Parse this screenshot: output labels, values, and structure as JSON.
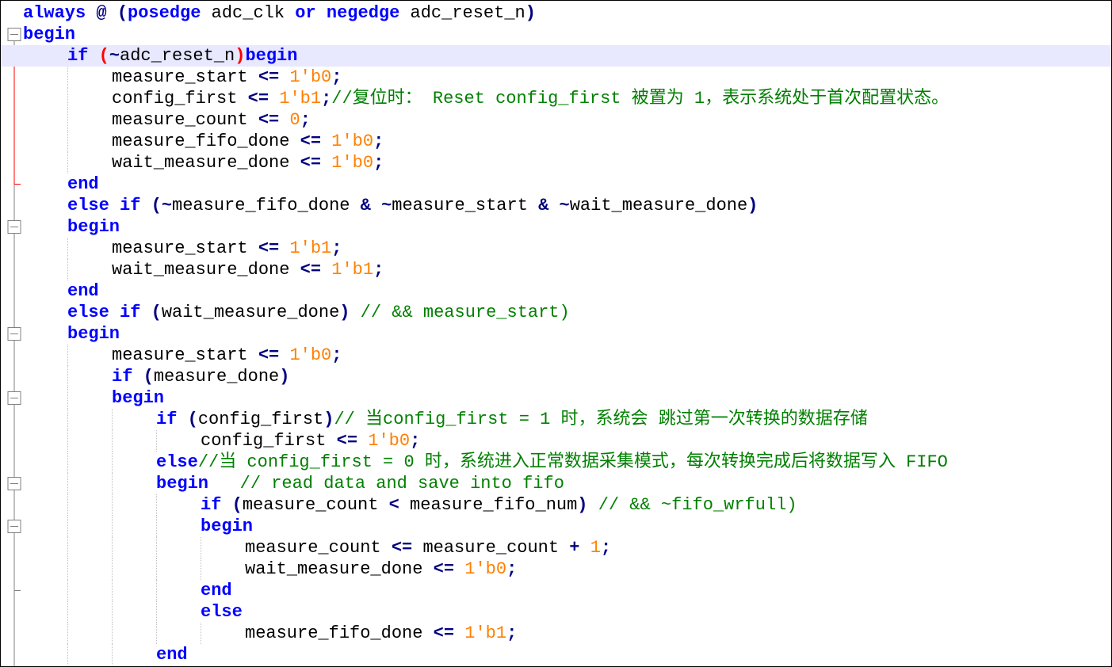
{
  "colors": {
    "keyword": "#0000ff",
    "operator": "#000080",
    "number": "#ff8000",
    "comment": "#008000",
    "current_line": "#e8e8ff",
    "fold_marker_current": "#ff0000",
    "fold_marker": "#808080"
  },
  "gutter": {
    "markers": [
      {
        "line": 1,
        "type": "fold-open"
      },
      {
        "line": 2,
        "type": "fold-open-current"
      },
      {
        "line": 8,
        "type": "fold-end-current"
      },
      {
        "line": 10,
        "type": "fold-open"
      },
      {
        "line": 15,
        "type": "fold-open"
      },
      {
        "line": 18,
        "type": "fold-open"
      },
      {
        "line": 22,
        "type": "fold-open"
      },
      {
        "line": 24,
        "type": "fold-open"
      },
      {
        "line": 27,
        "type": "fold-end"
      }
    ]
  },
  "code_lines": [
    {
      "indent": 0,
      "tokens": [
        {
          "t": "always",
          "c": "kw"
        },
        {
          "t": " ",
          "c": "plain"
        },
        {
          "t": "@",
          "c": "op"
        },
        {
          "t": " ",
          "c": "plain"
        },
        {
          "t": "(",
          "c": "op"
        },
        {
          "t": "posedge",
          "c": "kw"
        },
        {
          "t": " adc_clk ",
          "c": "plain"
        },
        {
          "t": "or",
          "c": "kw"
        },
        {
          "t": " ",
          "c": "plain"
        },
        {
          "t": "negedge",
          "c": "kw"
        },
        {
          "t": " adc_reset_n",
          "c": "plain"
        },
        {
          "t": ")",
          "c": "op"
        }
      ]
    },
    {
      "indent": 0,
      "tokens": [
        {
          "t": "begin",
          "c": "kw"
        }
      ]
    },
    {
      "indent": 1,
      "current": true,
      "tokens": [
        {
          "t": "if",
          "c": "kw"
        },
        {
          "t": " ",
          "c": "plain"
        },
        {
          "t": "(",
          "c": "red"
        },
        {
          "t": "~",
          "c": "op"
        },
        {
          "t": "adc_reset_n",
          "c": "plain"
        },
        {
          "t": ")",
          "c": "red"
        },
        {
          "t": "begin",
          "c": "kw"
        }
      ]
    },
    {
      "indent": 2,
      "tokens": [
        {
          "t": "measure_start ",
          "c": "plain"
        },
        {
          "t": "<=",
          "c": "op"
        },
        {
          "t": " ",
          "c": "plain"
        },
        {
          "t": "1'b0",
          "c": "num"
        },
        {
          "t": ";",
          "c": "op"
        }
      ]
    },
    {
      "indent": 2,
      "tokens": [
        {
          "t": "config_first ",
          "c": "plain"
        },
        {
          "t": "<=",
          "c": "op"
        },
        {
          "t": " ",
          "c": "plain"
        },
        {
          "t": "1'b1",
          "c": "num"
        },
        {
          "t": ";",
          "c": "op"
        },
        {
          "t": "//复位时： Reset config_first 被置为 1，表示系统处于首次配置状态。",
          "c": "cm"
        }
      ]
    },
    {
      "indent": 2,
      "tokens": [
        {
          "t": "measure_count ",
          "c": "plain"
        },
        {
          "t": "<=",
          "c": "op"
        },
        {
          "t": " ",
          "c": "plain"
        },
        {
          "t": "0",
          "c": "num"
        },
        {
          "t": ";",
          "c": "op"
        }
      ]
    },
    {
      "indent": 2,
      "tokens": [
        {
          "t": "measure_fifo_done ",
          "c": "plain"
        },
        {
          "t": "<=",
          "c": "op"
        },
        {
          "t": " ",
          "c": "plain"
        },
        {
          "t": "1'b0",
          "c": "num"
        },
        {
          "t": ";",
          "c": "op"
        }
      ]
    },
    {
      "indent": 2,
      "tokens": [
        {
          "t": "wait_measure_done ",
          "c": "plain"
        },
        {
          "t": "<=",
          "c": "op"
        },
        {
          "t": " ",
          "c": "plain"
        },
        {
          "t": "1'b0",
          "c": "num"
        },
        {
          "t": ";",
          "c": "op"
        }
      ]
    },
    {
      "indent": 1,
      "tokens": [
        {
          "t": "end",
          "c": "kw"
        }
      ]
    },
    {
      "indent": 1,
      "tokens": [
        {
          "t": "else",
          "c": "kw"
        },
        {
          "t": " ",
          "c": "plain"
        },
        {
          "t": "if",
          "c": "kw"
        },
        {
          "t": " ",
          "c": "plain"
        },
        {
          "t": "(~",
          "c": "op"
        },
        {
          "t": "measure_fifo_done ",
          "c": "plain"
        },
        {
          "t": "&",
          "c": "op"
        },
        {
          "t": " ",
          "c": "plain"
        },
        {
          "t": "~",
          "c": "op"
        },
        {
          "t": "measure_start ",
          "c": "plain"
        },
        {
          "t": "&",
          "c": "op"
        },
        {
          "t": " ",
          "c": "plain"
        },
        {
          "t": "~",
          "c": "op"
        },
        {
          "t": "wait_measure_done",
          "c": "plain"
        },
        {
          "t": ")",
          "c": "op"
        }
      ]
    },
    {
      "indent": 1,
      "tokens": [
        {
          "t": "begin",
          "c": "kw"
        }
      ]
    },
    {
      "indent": 2,
      "tokens": [
        {
          "t": "measure_start ",
          "c": "plain"
        },
        {
          "t": "<=",
          "c": "op"
        },
        {
          "t": " ",
          "c": "plain"
        },
        {
          "t": "1'b1",
          "c": "num"
        },
        {
          "t": ";",
          "c": "op"
        }
      ]
    },
    {
      "indent": 2,
      "tokens": [
        {
          "t": "wait_measure_done ",
          "c": "plain"
        },
        {
          "t": "<=",
          "c": "op"
        },
        {
          "t": " ",
          "c": "plain"
        },
        {
          "t": "1'b1",
          "c": "num"
        },
        {
          "t": ";",
          "c": "op"
        }
      ]
    },
    {
      "indent": 1,
      "tokens": [
        {
          "t": "end",
          "c": "kw"
        }
      ]
    },
    {
      "indent": 1,
      "tokens": [
        {
          "t": "else",
          "c": "kw"
        },
        {
          "t": " ",
          "c": "plain"
        },
        {
          "t": "if",
          "c": "kw"
        },
        {
          "t": " ",
          "c": "plain"
        },
        {
          "t": "(",
          "c": "op"
        },
        {
          "t": "wait_measure_done",
          "c": "plain"
        },
        {
          "t": ")",
          "c": "op"
        },
        {
          "t": " ",
          "c": "plain"
        },
        {
          "t": "// && measure_start)",
          "c": "cm"
        }
      ]
    },
    {
      "indent": 1,
      "tokens": [
        {
          "t": "begin",
          "c": "kw"
        }
      ]
    },
    {
      "indent": 2,
      "tokens": [
        {
          "t": "measure_start ",
          "c": "plain"
        },
        {
          "t": "<=",
          "c": "op"
        },
        {
          "t": " ",
          "c": "plain"
        },
        {
          "t": "1'b0",
          "c": "num"
        },
        {
          "t": ";",
          "c": "op"
        }
      ]
    },
    {
      "indent": 2,
      "tokens": [
        {
          "t": "if",
          "c": "kw"
        },
        {
          "t": " ",
          "c": "plain"
        },
        {
          "t": "(",
          "c": "op"
        },
        {
          "t": "measure_done",
          "c": "plain"
        },
        {
          "t": ")",
          "c": "op"
        }
      ]
    },
    {
      "indent": 2,
      "tokens": [
        {
          "t": "begin",
          "c": "kw"
        }
      ]
    },
    {
      "indent": 3,
      "tokens": [
        {
          "t": "if",
          "c": "kw"
        },
        {
          "t": " ",
          "c": "plain"
        },
        {
          "t": "(",
          "c": "op"
        },
        {
          "t": "config_first",
          "c": "plain"
        },
        {
          "t": ")",
          "c": "op"
        },
        {
          "t": "// 当config_first = 1 时，系统会 跳过第一次转换的数据存储",
          "c": "cm"
        }
      ]
    },
    {
      "indent": 4,
      "tokens": [
        {
          "t": "config_first ",
          "c": "plain"
        },
        {
          "t": "<=",
          "c": "op"
        },
        {
          "t": " ",
          "c": "plain"
        },
        {
          "t": "1'b0",
          "c": "num"
        },
        {
          "t": ";",
          "c": "op"
        }
      ]
    },
    {
      "indent": 3,
      "tokens": [
        {
          "t": "else",
          "c": "kw"
        },
        {
          "t": "//当 config_first = 0 时，系统进入正常数据采集模式，每次转换完成后将数据写入 FIFO",
          "c": "cm"
        }
      ]
    },
    {
      "indent": 3,
      "tokens": [
        {
          "t": "begin",
          "c": "kw"
        },
        {
          "t": "   ",
          "c": "plain"
        },
        {
          "t": "// read data and save into fifo",
          "c": "cm"
        }
      ]
    },
    {
      "indent": 4,
      "tokens": [
        {
          "t": "if",
          "c": "kw"
        },
        {
          "t": " ",
          "c": "plain"
        },
        {
          "t": "(",
          "c": "op"
        },
        {
          "t": "measure_count ",
          "c": "plain"
        },
        {
          "t": "<",
          "c": "op"
        },
        {
          "t": " measure_fifo_num",
          "c": "plain"
        },
        {
          "t": ")",
          "c": "op"
        },
        {
          "t": " ",
          "c": "plain"
        },
        {
          "t": "// && ~fifo_wrfull)",
          "c": "cm"
        }
      ]
    },
    {
      "indent": 4,
      "tokens": [
        {
          "t": "begin",
          "c": "kw"
        }
      ]
    },
    {
      "indent": 5,
      "tokens": [
        {
          "t": "measure_count ",
          "c": "plain"
        },
        {
          "t": "<=",
          "c": "op"
        },
        {
          "t": " measure_count ",
          "c": "plain"
        },
        {
          "t": "+",
          "c": "op"
        },
        {
          "t": " ",
          "c": "plain"
        },
        {
          "t": "1",
          "c": "num"
        },
        {
          "t": ";",
          "c": "op"
        }
      ]
    },
    {
      "indent": 5,
      "tokens": [
        {
          "t": "wait_measure_done ",
          "c": "plain"
        },
        {
          "t": "<=",
          "c": "op"
        },
        {
          "t": " ",
          "c": "plain"
        },
        {
          "t": "1'b0",
          "c": "num"
        },
        {
          "t": ";",
          "c": "op"
        }
      ]
    },
    {
      "indent": 4,
      "tokens": [
        {
          "t": "end",
          "c": "kw"
        }
      ]
    },
    {
      "indent": 4,
      "tokens": [
        {
          "t": "else",
          "c": "kw"
        }
      ]
    },
    {
      "indent": 5,
      "tokens": [
        {
          "t": "measure_fifo_done ",
          "c": "plain"
        },
        {
          "t": "<=",
          "c": "op"
        },
        {
          "t": " ",
          "c": "plain"
        },
        {
          "t": "1'b1",
          "c": "num"
        },
        {
          "t": ";",
          "c": "op"
        }
      ]
    },
    {
      "indent": 3,
      "tokens": [
        {
          "t": "end",
          "c": "kw"
        }
      ]
    }
  ]
}
